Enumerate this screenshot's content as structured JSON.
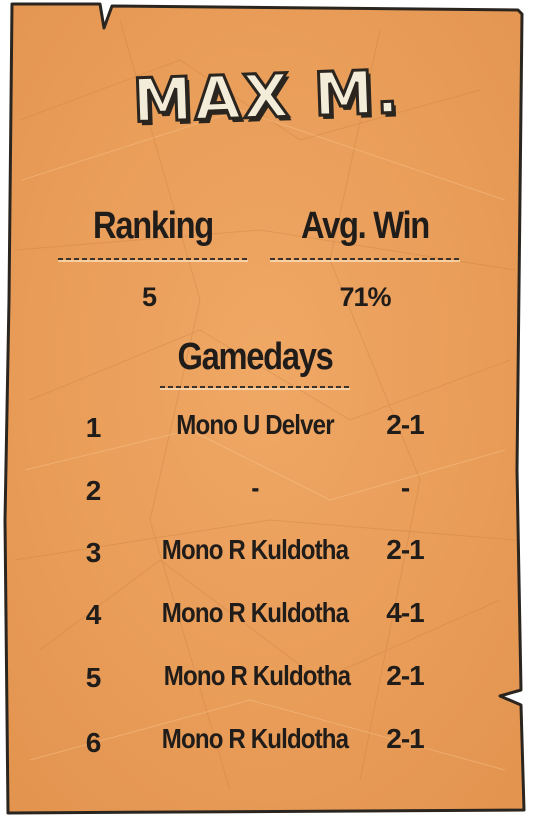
{
  "title": "MAX M.",
  "stats": {
    "ranking_label": "Ranking",
    "avg_win_label": "Avg. Win",
    "ranking_value": "5",
    "avg_win_value": "71%"
  },
  "gamedays_label": "Gamedays",
  "gamedays": [
    {
      "day": "1",
      "deck": "Mono U Delver",
      "record": "2-1"
    },
    {
      "day": "2",
      "deck": "-",
      "record": "-"
    },
    {
      "day": "3",
      "deck": "Mono R Kuldotha",
      "record": "2-1"
    },
    {
      "day": "4",
      "deck": "Mono R Kuldotha",
      "record": "4-1"
    },
    {
      "day": "5",
      "deck": "Mono R Kuldotha",
      "record": "2-1"
    },
    {
      "day": "6",
      "deck": "Mono R Kuldotha",
      "record": "2-1"
    }
  ],
  "colors": {
    "paper": "#eda261",
    "paper_edge": "#2b2520",
    "text": "#1f1c1a"
  }
}
